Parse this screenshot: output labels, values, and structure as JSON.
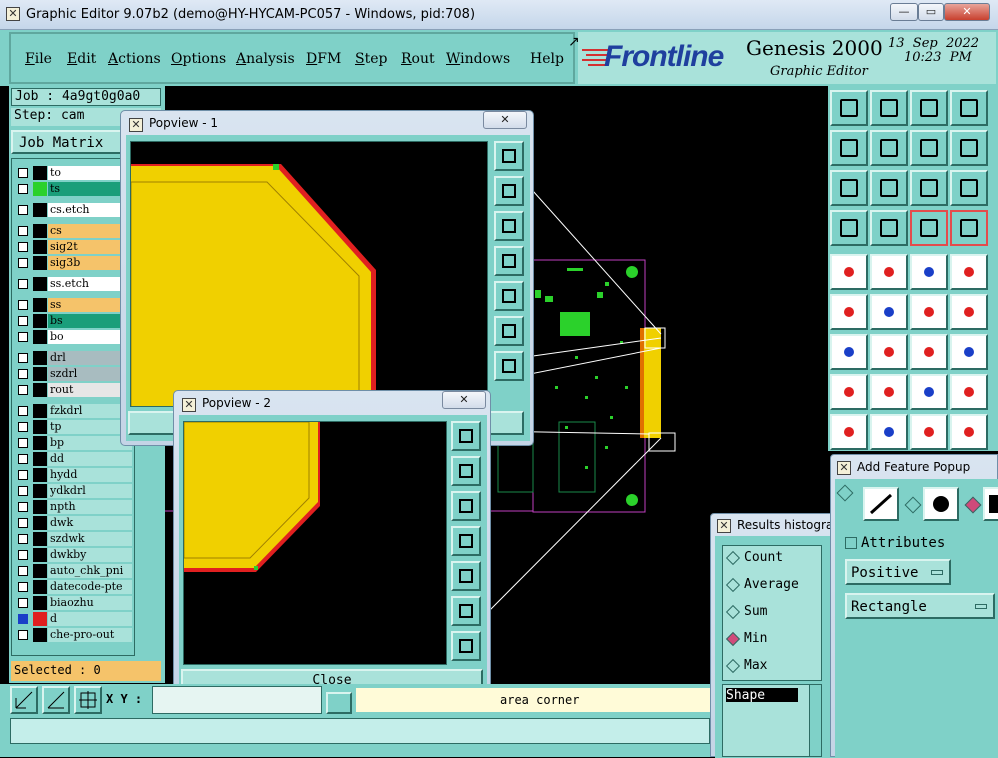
{
  "window": {
    "title": "Graphic Editor 9.07b2 (demo@HY-HYCAM-PC057 - Windows, pid:708)",
    "minimize": "—",
    "maximize": "▭",
    "close": "✕"
  },
  "menu": {
    "items": [
      {
        "label": "File",
        "u": "F",
        "rest": "ile"
      },
      {
        "label": "Edit",
        "u": "E",
        "rest": "dit"
      },
      {
        "label": "Actions",
        "u": "A",
        "rest": "ctions"
      },
      {
        "label": "Options",
        "u": "O",
        "rest": "ptions"
      },
      {
        "label": "Analysis",
        "u": "A",
        "rest": "nalysis"
      },
      {
        "label": "DFM",
        "u": "D",
        "rest": "FM"
      },
      {
        "label": "Step",
        "u": "S",
        "rest": "tep"
      },
      {
        "label": "Rout",
        "u": "R",
        "rest": "out"
      },
      {
        "label": "Windows",
        "u": "W",
        "rest": "indows"
      },
      {
        "label": "Help",
        "u": "",
        "rest": "Help"
      }
    ]
  },
  "brand": {
    "logo": "Frontline",
    "product": "Genesis 2000",
    "subtitle": "Graphic Editor",
    "date": "13  Sep  2022",
    "time": "10:23  PM"
  },
  "job": {
    "job_line": "Job : 4a9gt0g0a0",
    "step_line": "Step: cam",
    "matrix_button": "Job Matrix",
    "selected": "Selected : 0"
  },
  "layers": [
    {
      "name": "to",
      "color": "#ffffff",
      "swatch": "#000000"
    },
    {
      "name": "ts",
      "color": "#1a9e7a",
      "swatch": "#2bd12b"
    },
    {
      "name": "cs.etch",
      "color": "#ffffff",
      "swatch": "#000000"
    },
    {
      "name": "cs",
      "color": "#f5c36a",
      "swatch": "#000000"
    },
    {
      "name": "sig2t",
      "color": "#f5c36a",
      "swatch": "#000000"
    },
    {
      "name": "sig3b",
      "color": "#f5c36a",
      "swatch": "#000000"
    },
    {
      "name": "ss.etch",
      "color": "#ffffff",
      "swatch": "#000000"
    },
    {
      "name": "ss",
      "color": "#f5c36a",
      "swatch": "#000000"
    },
    {
      "name": "bs",
      "color": "#1a9e7a",
      "swatch": "#000000"
    },
    {
      "name": "bo",
      "color": "#ffffff",
      "swatch": "#000000"
    },
    {
      "name": "drl",
      "color": "#a8bcc0",
      "swatch": "#000000"
    },
    {
      "name": "szdrl",
      "color": "#a8bcc0",
      "swatch": "#000000"
    },
    {
      "name": "rout",
      "color": "#e6e6e6",
      "swatch": "#000000"
    },
    {
      "name": "fzkdrl",
      "color": "#a9e2da",
      "swatch": "#000000"
    },
    {
      "name": "tp",
      "color": "#a9e2da",
      "swatch": "#000000"
    },
    {
      "name": "bp",
      "color": "#a9e2da",
      "swatch": "#000000"
    },
    {
      "name": "dd",
      "color": "#a9e2da",
      "swatch": "#000000"
    },
    {
      "name": "hydd",
      "color": "#a9e2da",
      "swatch": "#000000"
    },
    {
      "name": "ydkdrl",
      "color": "#a9e2da",
      "swatch": "#000000"
    },
    {
      "name": "npth",
      "color": "#a9e2da",
      "swatch": "#000000"
    },
    {
      "name": "dwk",
      "color": "#a9e2da",
      "swatch": "#000000"
    },
    {
      "name": "szdwk",
      "color": "#a9e2da",
      "swatch": "#000000"
    },
    {
      "name": "dwkby",
      "color": "#a9e2da",
      "swatch": "#000000"
    },
    {
      "name": "auto_chk_pni",
      "color": "#a9e2da",
      "swatch": "#000000"
    },
    {
      "name": "datecode-pte",
      "color": "#a9e2da",
      "swatch": "#000000"
    },
    {
      "name": "biaozhu",
      "color": "#a9e2da",
      "swatch": "#000000"
    },
    {
      "name": "d",
      "color": "#a9e2da",
      "swatch": "#e02020"
    },
    {
      "name": "che-pro-out",
      "color": "#a9e2da",
      "swatch": "#000000"
    }
  ],
  "popview1": {
    "title": "Popview - 1"
  },
  "popview2": {
    "title": "Popview - 2",
    "close_button": "Close"
  },
  "status": {
    "xy_label": "X Y :",
    "message": "area corner"
  },
  "results": {
    "title": "Results histogra",
    "options": [
      "Count",
      "Average",
      "Sum",
      "Min",
      "Max"
    ],
    "selected": "Min",
    "shape_label": "Shape"
  },
  "add_feature": {
    "title": "Add Feature Popup",
    "attributes": "Attributes",
    "polarity": "Positive",
    "shape": "Rectangle"
  }
}
